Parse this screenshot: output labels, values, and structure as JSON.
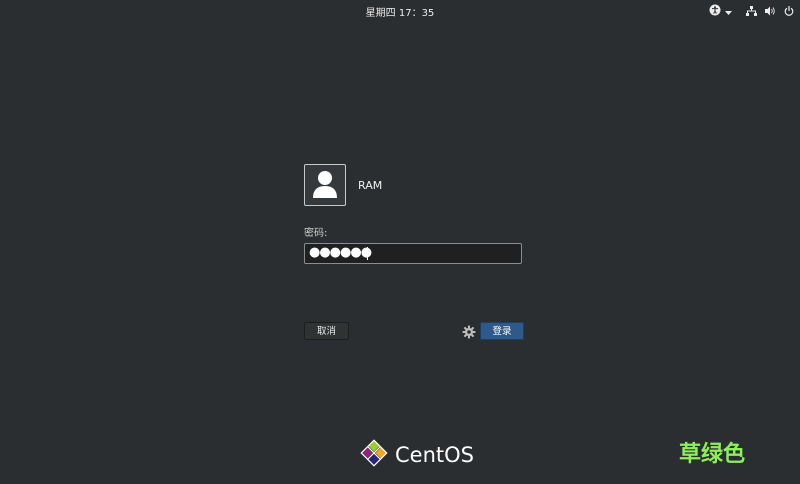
{
  "topbar": {
    "datetime": "星期四 17：35",
    "icons": [
      "accessibility-icon",
      "chevron-down-icon",
      "network-icon",
      "volume-icon",
      "power-icon"
    ]
  },
  "login": {
    "username": "RAM",
    "password_label": "密码:",
    "password_mask": "●●●●●●",
    "cancel_label": "取消",
    "login_label": "登录"
  },
  "branding": {
    "logo_text": "CentOS",
    "watermark": "草绿色"
  },
  "colors": {
    "background": "#2b2e30",
    "login_button": "#2d5a8a",
    "watermark": "#8cf05a"
  }
}
